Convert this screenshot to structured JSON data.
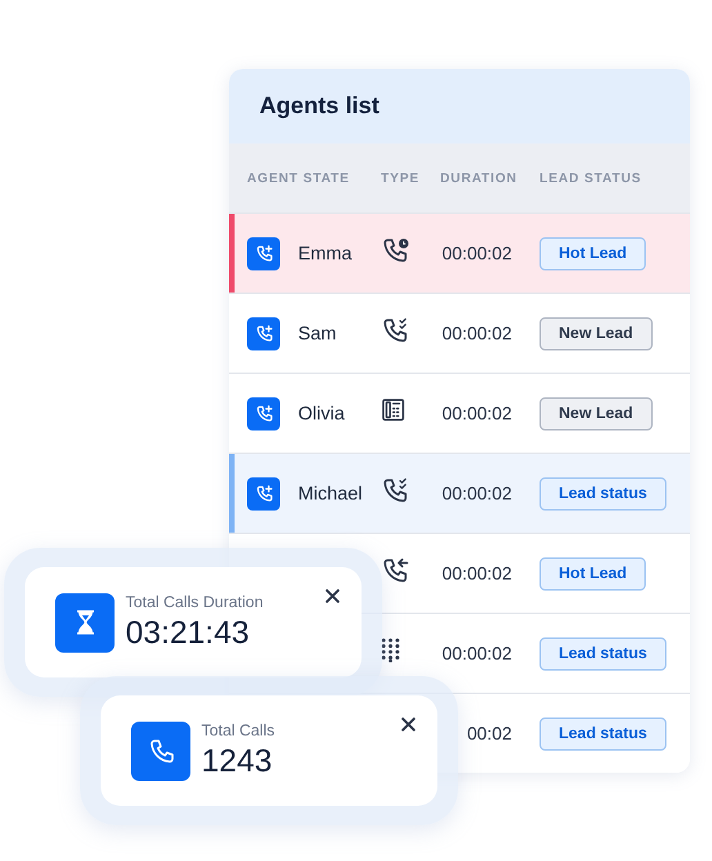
{
  "agents_list": {
    "title": "Agents list",
    "columns": [
      "AGENT STATE",
      "TYPE",
      "DURATION",
      "LEAD STATUS"
    ],
    "rows": [
      {
        "agent": "Emma",
        "type": {
          "kind": "scheduled"
        },
        "duration": "00:00:02",
        "lead_status": {
          "label": "Hot Lead",
          "kind": "hot"
        },
        "color": "#ef4a6a"
      },
      {
        "agent": "Sam",
        "type": {
          "kind": "answered"
        },
        "duration": "00:00:02",
        "lead_status": {
          "label": "New Lead",
          "kind": "new"
        }
      },
      {
        "agent": "Olivia",
        "type": {
          "kind": "fax"
        },
        "duration": "00:00:02",
        "lead_status": {
          "label": "New Lead",
          "kind": "new"
        }
      },
      {
        "agent": "Michael",
        "type": {
          "kind": "answered"
        },
        "duration": "00:00:02",
        "lead_status": {
          "label": "Lead status",
          "kind": "status"
        },
        "color": "#7eb3f5"
      },
      {
        "type": {
          "kind": "incoming"
        },
        "duration": "00:00:02",
        "lead_status": {
          "label": "Hot Lead",
          "kind": "hot"
        }
      },
      {
        "type": {
          "kind": "dialpad"
        },
        "duration": "00:00:02",
        "lead_status": {
          "label": "Lead status",
          "kind": "status"
        }
      },
      {
        "duration": "00:02",
        "lead_status": {
          "label": "Lead status",
          "kind": "status"
        }
      }
    ]
  },
  "toasts": [
    {
      "label": "Total Calls Duration",
      "value": "03:21:43",
      "kind": "hourglass"
    },
    {
      "label": "Total Calls",
      "value": "1243",
      "kind": "phone"
    }
  ]
}
